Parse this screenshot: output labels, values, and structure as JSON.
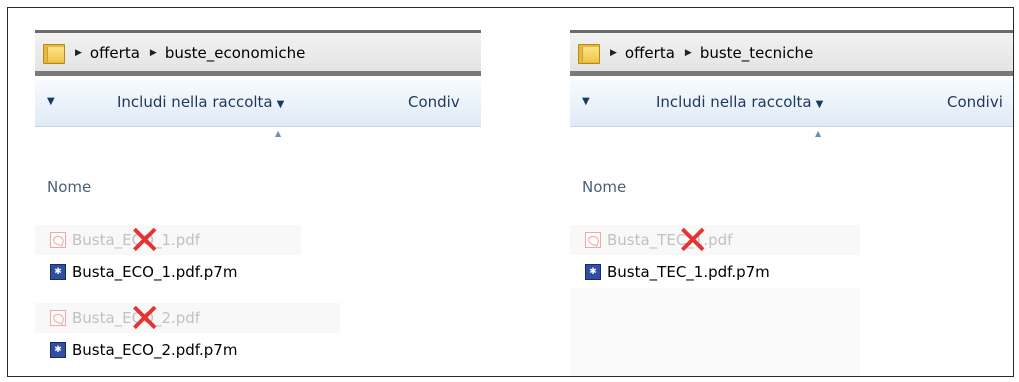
{
  "left": {
    "breadcrumbs": [
      "offerta",
      "buste_economiche"
    ],
    "toolbar": {
      "include_label": "Includi nella raccolta",
      "share_label": "Condiv"
    },
    "column_header": "Nome",
    "files": [
      {
        "name": "Busta_ECO_1.pdf",
        "type": "pdf",
        "deleted": true
      },
      {
        "name": "Busta_ECO_1.pdf.p7m",
        "type": "p7m",
        "deleted": false
      },
      {
        "name": "Busta_ECO_2.pdf",
        "type": "pdf",
        "deleted": true
      },
      {
        "name": "Busta_ECO_2.pdf.p7m",
        "type": "p7m",
        "deleted": false
      }
    ]
  },
  "right": {
    "breadcrumbs": [
      "offerta",
      "buste_tecniche"
    ],
    "toolbar": {
      "include_label": "Includi nella raccolta",
      "share_label": "Condivi"
    },
    "column_header": "Nome",
    "files": [
      {
        "name": "Busta_TEC_1.pdf",
        "type": "pdf",
        "deleted": true
      },
      {
        "name": "Busta_TEC_1.pdf.p7m",
        "type": "p7m",
        "deleted": false
      }
    ]
  },
  "icons": {
    "folder": "folder-icon",
    "pdf": "pdf-file-icon",
    "p7m": "signed-file-icon",
    "deleted_mark": "red-x-mark"
  },
  "colors": {
    "deleted_mark": "#d11111",
    "toolbar_text": "#1e395b"
  }
}
